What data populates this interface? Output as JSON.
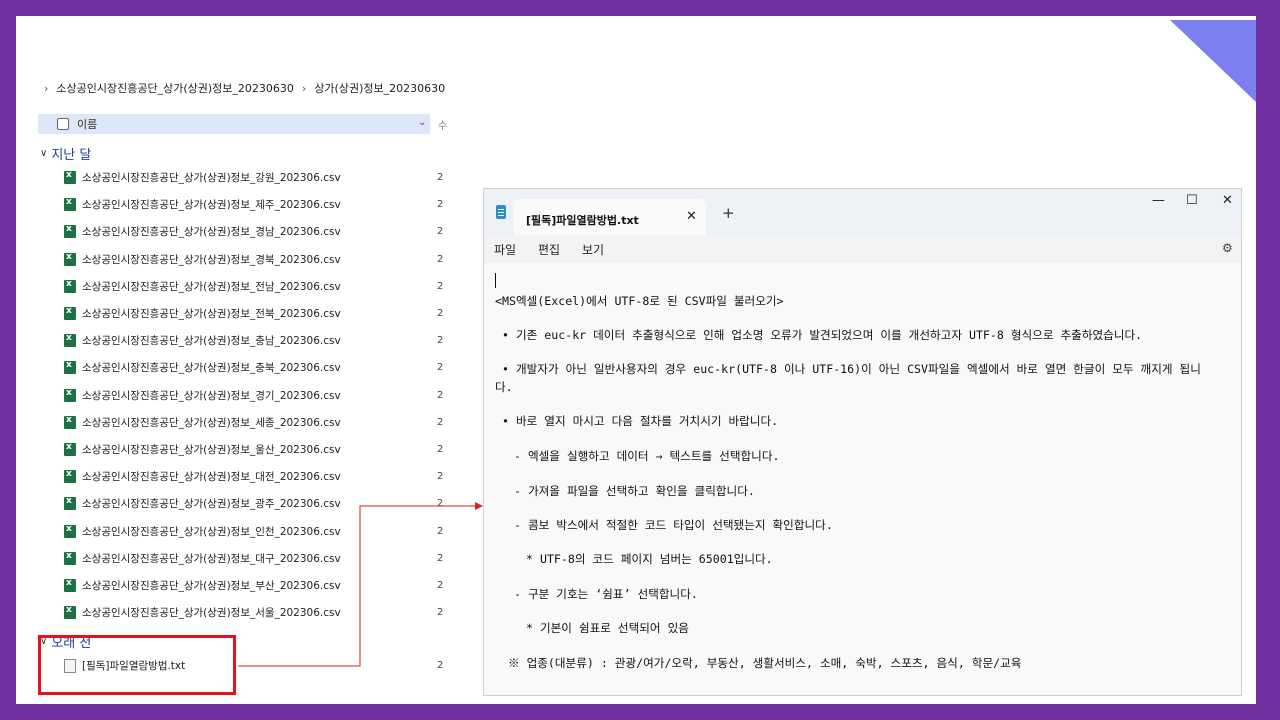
{
  "explorer": {
    "breadcrumb": [
      "소상공인시장진흥공단_상가(상권)정보_20230630",
      "상가(상권)정보_20230630"
    ],
    "column_name": "이름",
    "column_second_hint": "수",
    "group_last_month": "지난 달",
    "group_older": "오래 전",
    "files": [
      "소상공인시장진흥공단_상가(상권)정보_강원_202306.csv",
      "소상공인시장진흥공단_상가(상권)정보_제주_202306.csv",
      "소상공인시장진흥공단_상가(상권)정보_경남_202306.csv",
      "소상공인시장진흥공단_상가(상권)정보_경북_202306.csv",
      "소상공인시장진흥공단_상가(상권)정보_전남_202306.csv",
      "소상공인시장진흥공단_상가(상권)정보_전북_202306.csv",
      "소상공인시장진흥공단_상가(상권)정보_충남_202306.csv",
      "소상공인시장진흥공단_상가(상권)정보_충북_202306.csv",
      "소상공인시장진흥공단_상가(상권)정보_경기_202306.csv",
      "소상공인시장진흥공단_상가(상권)정보_세종_202306.csv",
      "소상공인시장진흥공단_상가(상권)정보_울산_202306.csv",
      "소상공인시장진흥공단_상가(상권)정보_대전_202306.csv",
      "소상공인시장진흥공단_상가(상권)정보_광주_202306.csv",
      "소상공인시장진흥공단_상가(상권)정보_인천_202306.csv",
      "소상공인시장진흥공단_상가(상권)정보_대구_202306.csv",
      "소상공인시장진흥공단_상가(상권)정보_부산_202306.csv",
      "소상공인시장진흥공단_상가(상권)정보_서울_202306.csv"
    ],
    "date_fragment": "2",
    "old_file": "[필독]파일열람방법.txt",
    "excel_icon_letter": "x",
    "highlight_color": "#e0141c"
  },
  "notepad": {
    "tab_title": "[필독]파일열람방법.txt",
    "menu": [
      "파일",
      "편집",
      "보기"
    ],
    "window_buttons": {
      "minimize": "—",
      "maximize": "☐",
      "close": "✕"
    },
    "new_tab": "+",
    "close_tab": "✕",
    "settings_icon": "⚙",
    "lines": [
      "<MS엑셀(Excel)에서 UTF-8로 된 CSV파일 불러오기>",
      "• 기존 euc-kr 데이터 추출형식으로 인해 업소명 오류가 발견되었으며 이를 개선하고자 UTF-8 형식으로 추출하였습니다.",
      "• 개발자가 아닌 일반사용자의 경우 euc-kr(UTF-8 이나 UTF-16)이 아닌 CSV파일을 엑셀에서 바로 열면 한글이 모두 깨지게 됩니",
      "다.",
      "• 바로 열지 마시고 다음 절차를 거치시기 바랍니다.",
      "- 엑셀을 실행하고 데이터 → 텍스트를 선택합니다.",
      "- 가져올 파일을 선택하고 확인을 클릭합니다.",
      "- 콤보 박스에서 적절한 코드 타입이 선택됐는지 확인합니다.",
      "* UTF-8의 코드 페이지 넘버는 65001입니다.",
      "- 구분 기호는 ‘쉼표’ 선택합니다.",
      "* 기본이 쉼표로 선택되어 있음",
      "※ 업종(대분류) : 관광/여가/오락, 부동산, 생활서비스, 소매, 숙박, 스포츠, 음식, 학문/교육"
    ]
  },
  "colors": {
    "frame": "#7030a0",
    "accent_triangle": "#7b7ff0",
    "excel_green": "#1e7145",
    "arrow_red": "#d42020"
  }
}
